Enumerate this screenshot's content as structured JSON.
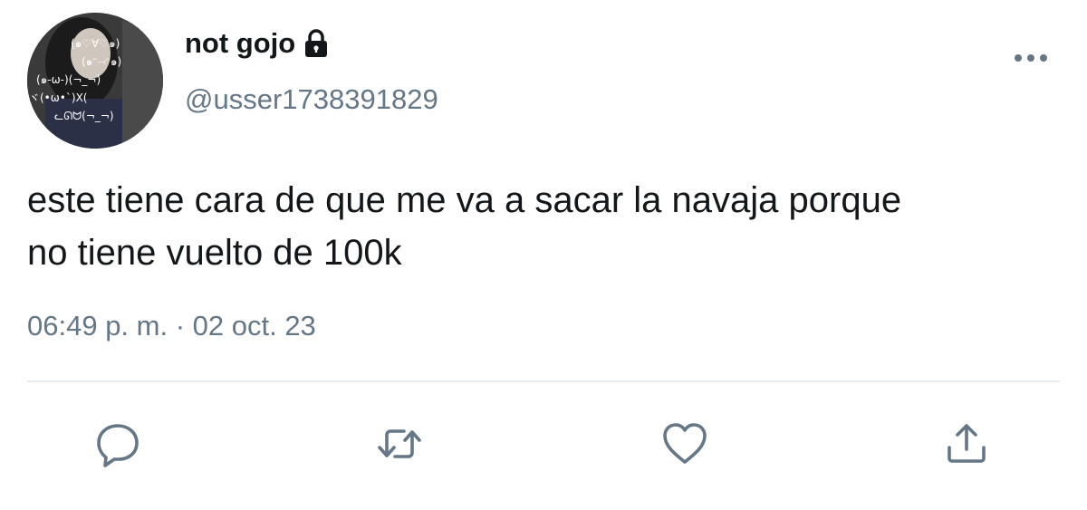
{
  "user": {
    "display_name": "not gojo",
    "handle": "@usser1738391829",
    "avatar_text": [
      "(๑♡∀♡๑)",
      "(๑ᵔ⤙ᵔ๑)",
      "(๑-ω-)(¬_¬)",
      "ヾ(•ω•`)X(",
      "ᓚᘏᗢ(¬_¬)"
    ]
  },
  "tweet": {
    "text": "este tiene cara de que me va a sacar la navaja porque\nno tiene vuelto de 100k",
    "timestamp": "06:49 p. m. · 02 oct. 23"
  },
  "icons": {
    "lock": "lock-icon",
    "more": "more-horizontal-icon",
    "reply": "reply-icon",
    "retweet": "retweet-icon",
    "like": "heart-icon",
    "share": "share-icon"
  },
  "colors": {
    "text_primary": "#14171a",
    "text_secondary": "#657786",
    "icon": "#657786",
    "divider": "#e6ecf0"
  }
}
